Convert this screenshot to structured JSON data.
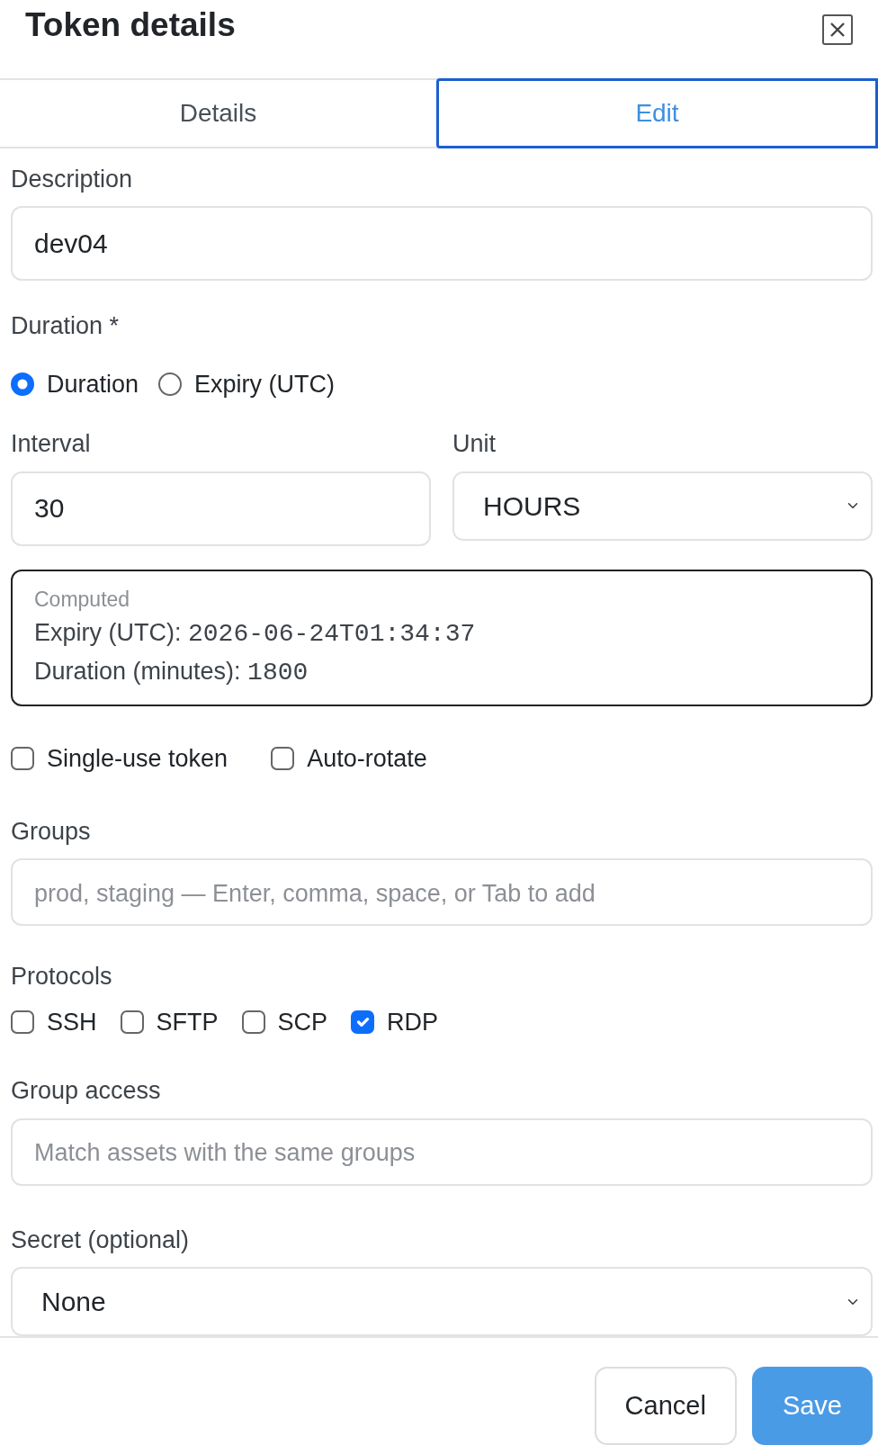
{
  "dialog": {
    "title": "Token details"
  },
  "tabs": [
    {
      "label": "Details",
      "selected": false
    },
    {
      "label": "Edit",
      "selected": true
    }
  ],
  "description": {
    "label": "Description",
    "value": "dev04"
  },
  "duration": {
    "label": "Duration *",
    "options": [
      {
        "label": "Duration",
        "selected": true
      },
      {
        "label": "Expiry (UTC)",
        "selected": false
      }
    ]
  },
  "interval": {
    "label": "Interval",
    "value": "30"
  },
  "unit": {
    "label": "Unit",
    "value": "HOURS"
  },
  "computed": {
    "title": "Computed",
    "lines": [
      {
        "label": "Expiry (UTC): ",
        "value": "2026-06-24T01:34:37"
      },
      {
        "label": "Duration (minutes): ",
        "value": "1800"
      }
    ]
  },
  "options": [
    {
      "label": "Single-use token",
      "checked": false
    },
    {
      "label": "Auto-rotate",
      "checked": false
    }
  ],
  "groups": {
    "label": "Groups",
    "placeholder": "prod, staging — Enter, comma, space, or Tab to add"
  },
  "protocols": {
    "label": "Protocols",
    "items": [
      {
        "label": "SSH",
        "checked": false
      },
      {
        "label": "SFTP",
        "checked": false
      },
      {
        "label": "SCP",
        "checked": false
      },
      {
        "label": "RDP",
        "checked": true
      }
    ]
  },
  "group_access": {
    "label": "Group access",
    "placeholder": "Match assets with the same groups"
  },
  "secret": {
    "label": "Secret (optional)",
    "value": "None"
  },
  "buttons": [
    {
      "label": "Cancel",
      "kind": "secondary"
    },
    {
      "label": "Save",
      "kind": "primary"
    }
  ]
}
